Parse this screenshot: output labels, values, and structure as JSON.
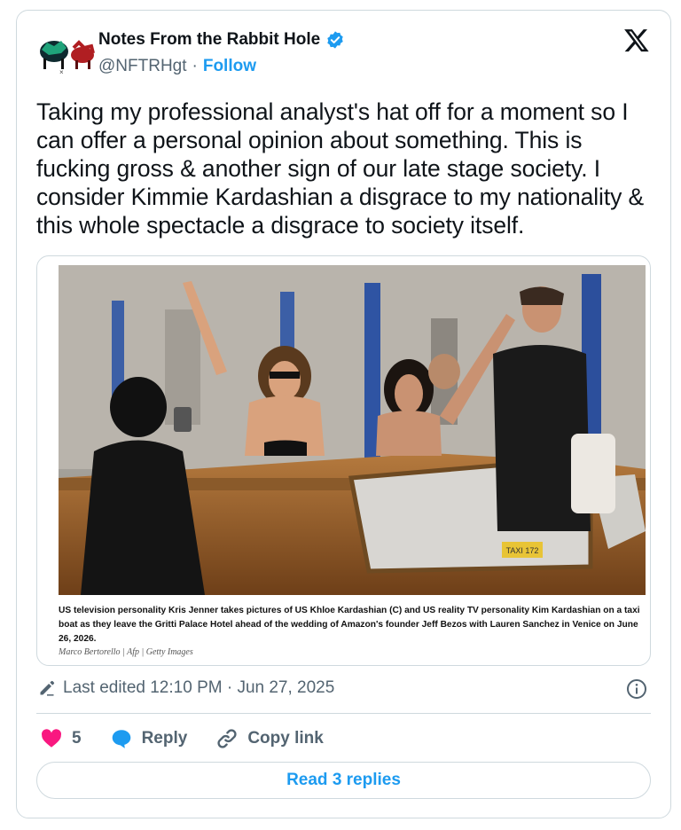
{
  "author": {
    "name": "Notes From the Rabbit Hole",
    "handle": "@NFTRHgt",
    "separator": "·",
    "follow_label": "Follow"
  },
  "tweet": {
    "text": "Taking my professional analyst's hat off for a moment so I can offer a personal opinion about something. This is fucking gross & another sign of our late stage society. I consider Kimmie Kardashian a disgrace to my nationality & this whole spectacle a disgrace to society itself."
  },
  "media": {
    "caption": "US television personality Kris Jenner takes pictures of US Khloe Kardashian (C) and US reality TV personality Kim Kardashian on a taxi boat as they leave the Gritti Palace Hotel ahead of the wedding of Amazon's founder Jeff Bezos with Lauren Sanchez in Venice on June 26, 2026.",
    "credit": "Marco Bertorello | Afp | Getty Images",
    "boat_plate": "TAXI 172"
  },
  "meta": {
    "edited_label": "Last edited 12:10 PM · Jun 27, 2025"
  },
  "actions": {
    "like_count": "5",
    "reply_label": "Reply",
    "copy_link_label": "Copy link",
    "read_replies_label": "Read 3 replies"
  },
  "colors": {
    "accent": "#1d9bf0",
    "like": "#f91880",
    "text": "#0f1419",
    "muted": "#536471",
    "border": "#cfd9de"
  },
  "icons": [
    "avatar-logo",
    "verified-badge-icon",
    "x-logo-icon",
    "pencil-icon",
    "info-icon",
    "heart-icon",
    "reply-bubble-icon",
    "link-icon"
  ]
}
